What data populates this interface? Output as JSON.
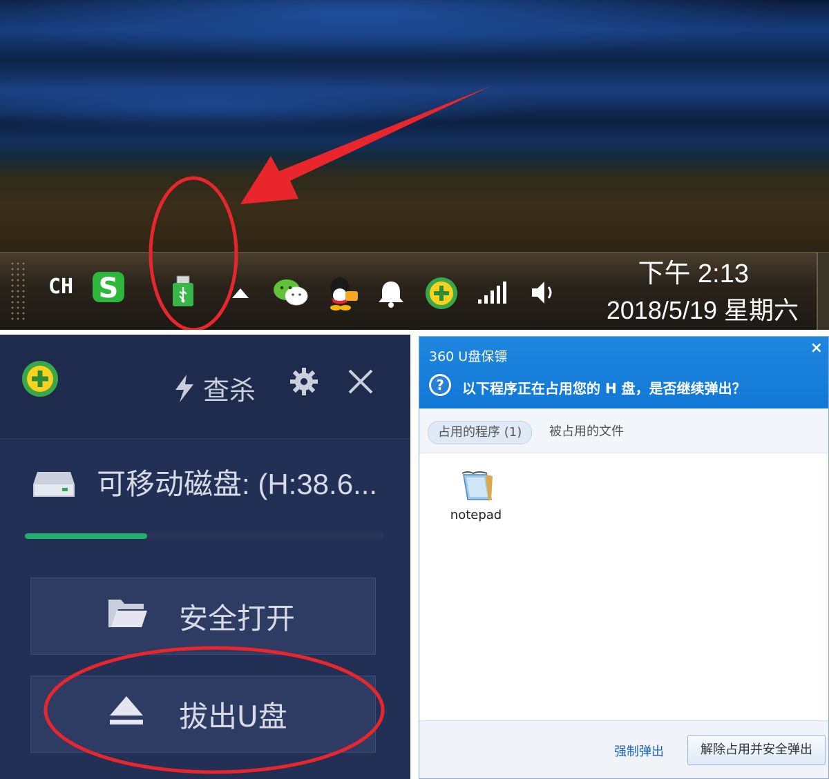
{
  "taskbar": {
    "language": "CH",
    "clock_time": "下午 2:13",
    "clock_date": "2018/5/19 星期六",
    "icons": [
      "sogou-input-icon",
      "usb-drive-icon",
      "show-hidden-icons-arrow",
      "wechat-icon",
      "qq-icon",
      "notification-bell-icon",
      "360-security-icon",
      "network-signal-icon",
      "volume-icon"
    ]
  },
  "left_panel": {
    "scan_label": "查杀",
    "drive_name": "可移动磁盘: (H:38.6...",
    "usage_fraction": 0.34,
    "open_button_label": "安全打开",
    "eject_button_label": "拔出U盘"
  },
  "dialog": {
    "title": "360 U盘保镖",
    "close_symbol": "×",
    "question": "以下程序正在占用您的 H 盘，是否继续弹出？",
    "tab_programs": "占用的程序 (1)",
    "tab_files": "被占用的文件",
    "program_name": "notepad",
    "force_eject_label": "强制弹出",
    "safe_eject_label": "解除占用并安全弹出"
  },
  "colors": {
    "annotation_red": "#e8262b",
    "panel_bg": "#233055",
    "dialog_blue": "#1178d6",
    "progress_green": "#1fb06b"
  }
}
